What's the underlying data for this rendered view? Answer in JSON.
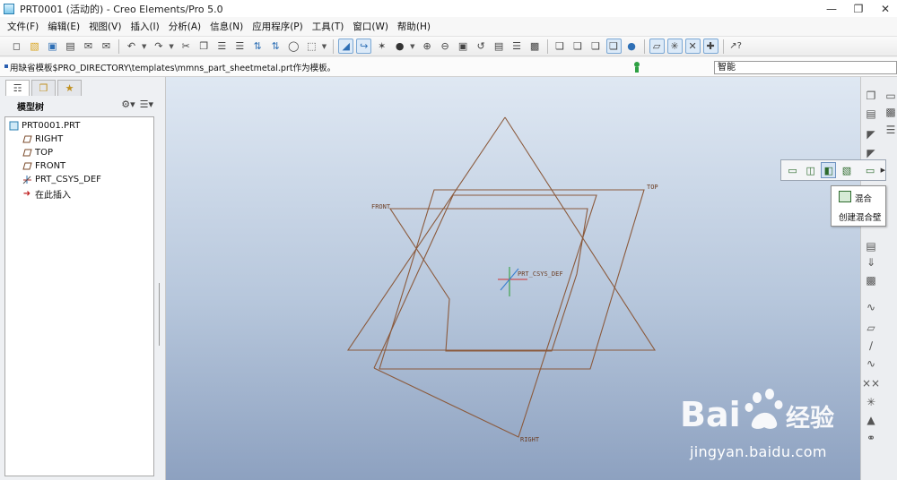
{
  "window": {
    "title": "PRT0001 (活动的) - Creo Elements/Pro 5.0",
    "controls": [
      "minimize-icon",
      "restore-icon",
      "close-icon"
    ]
  },
  "menubar": {
    "items": [
      {
        "label": "文件(F)"
      },
      {
        "label": "编辑(E)"
      },
      {
        "label": "视图(V)"
      },
      {
        "label": "插入(I)"
      },
      {
        "label": "分析(A)"
      },
      {
        "label": "信息(N)"
      },
      {
        "label": "应用程序(P)"
      },
      {
        "label": "工具(T)"
      },
      {
        "label": "窗口(W)"
      },
      {
        "label": "帮助(H)"
      }
    ]
  },
  "toolbar": {
    "icons": [
      "new-icon",
      "open-icon",
      "save-icon",
      "print-icon",
      "email-icon",
      "email-link-icon",
      "undo-icon",
      "redo-icon",
      "cut-icon",
      "copy-icon",
      "paste-icon",
      "paste-special-icon",
      "regenerate-icon",
      "regen-manager-icon",
      "find-icon",
      "select-box-icon",
      "datum-plane-display-icon",
      "datum-axis-display-icon",
      "spin-center-icon",
      "shading-icon",
      "zoom-in-icon",
      "zoom-out-icon",
      "refit-icon",
      "reorient-icon",
      "saved-views-icon",
      "layers-icon",
      "view-manager-icon",
      "wireframe-icon",
      "hidden-line-icon",
      "no-hidden-icon",
      "shaded-icon",
      "enhanced-realism-icon",
      "plane-display-icon",
      "axis-display-icon",
      "point-display-icon",
      "csys-display-icon",
      "context-help-icon"
    ]
  },
  "message_bar": {
    "text": "用缺省模板$PRO_DIRECTORY\\templates\\mmns_part_sheetmetal.prt作为模板。",
    "filter_value": "智能"
  },
  "left_panel": {
    "tabs": [
      "model-tree-tab-icon",
      "layer-tree-tab-icon",
      "favorites-tab-icon"
    ],
    "tree_title": "模型树",
    "tree_items": [
      {
        "label": "PRT0001.PRT",
        "icon": "part-icon"
      },
      {
        "label": "RIGHT",
        "icon": "datum-plane-icon"
      },
      {
        "label": "TOP",
        "icon": "datum-plane-icon"
      },
      {
        "label": "FRONT",
        "icon": "datum-plane-icon"
      },
      {
        "label": "PRT_CSYS_DEF",
        "icon": "csys-icon"
      },
      {
        "label": "在此插入",
        "icon": "insert-arrow-icon"
      }
    ]
  },
  "graphics": {
    "datum_labels": {
      "front": "FRONT",
      "top": "TOP",
      "right": "RIGHT",
      "csys": "PRT_CSYS_DEF"
    },
    "plane_color": "#8b5a3c"
  },
  "flyout": {
    "icons": [
      "extrude-feature-icon",
      "revolve-feature-icon",
      "blend-feature-icon",
      "swept-blend-icon"
    ],
    "tooltip_title": "混合",
    "tooltip_desc": "创建混合壁"
  },
  "right_toolbar": {
    "icons": [
      "flat-wall-icon",
      "unattached-wall-icon",
      "bend-icon",
      "unbend-icon",
      "sketched-form-icon",
      "extrude-wall-icon",
      "rip-icon",
      "corner-relief-icon",
      "bend-back-icon",
      "flatten-icon",
      "sketch-tool-icon",
      "datum-plane-tool-icon",
      "datum-axis-tool-icon",
      "datum-curve-icon",
      "datum-point-icon",
      "csys-tool-icon",
      "analysis-icon",
      "snap-icon"
    ]
  },
  "watermark": {
    "brand": "Bai du 经验",
    "url": "jingyan.baidu.com"
  }
}
